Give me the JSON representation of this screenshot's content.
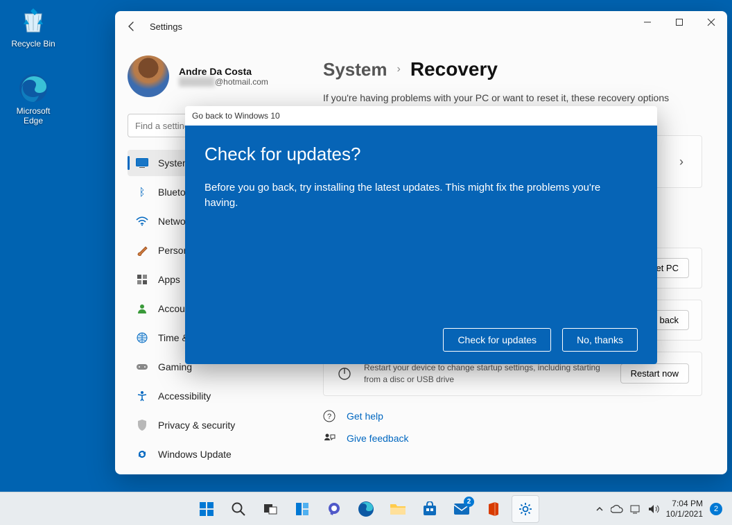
{
  "desktop": {
    "recycle_bin": "Recycle Bin",
    "edge": "Microsoft Edge"
  },
  "window": {
    "title": "Settings",
    "profile": {
      "name": "Andre Da Costa",
      "email_suffix": "@hotmail.com"
    },
    "search_placeholder": "Find a setting",
    "nav": {
      "system": "System",
      "bluetooth": "Bluetooth & devices",
      "network": "Network & internet",
      "personalization": "Personalization",
      "apps": "Apps",
      "accounts": "Accounts",
      "time": "Time & language",
      "gaming": "Gaming",
      "accessibility": "Accessibility",
      "privacy": "Privacy & security",
      "update": "Windows Update"
    },
    "breadcrumb": {
      "parent": "System",
      "current": "Recovery"
    },
    "subtext": "If you're having problems with your PC or want to reset it, these recovery options might help.",
    "cards": {
      "reset_pc_btn": "Reset PC",
      "go_back_btn": "Go back",
      "advanced_text": "Restart your device to change startup settings, including starting from a disc or USB drive",
      "advanced_btn": "Restart now"
    },
    "help": {
      "get_help": "Get help",
      "feedback": "Give feedback"
    }
  },
  "modal": {
    "title": "Go back to Windows 10",
    "heading": "Check for updates?",
    "body": "Before you go back, try installing the latest updates. This might fix the problems you're having.",
    "primary": "Check for updates",
    "secondary": "No, thanks"
  },
  "taskbar": {
    "mail_badge": "2",
    "time": "7:04 PM",
    "date": "10/1/2021",
    "notif_count": "2"
  }
}
